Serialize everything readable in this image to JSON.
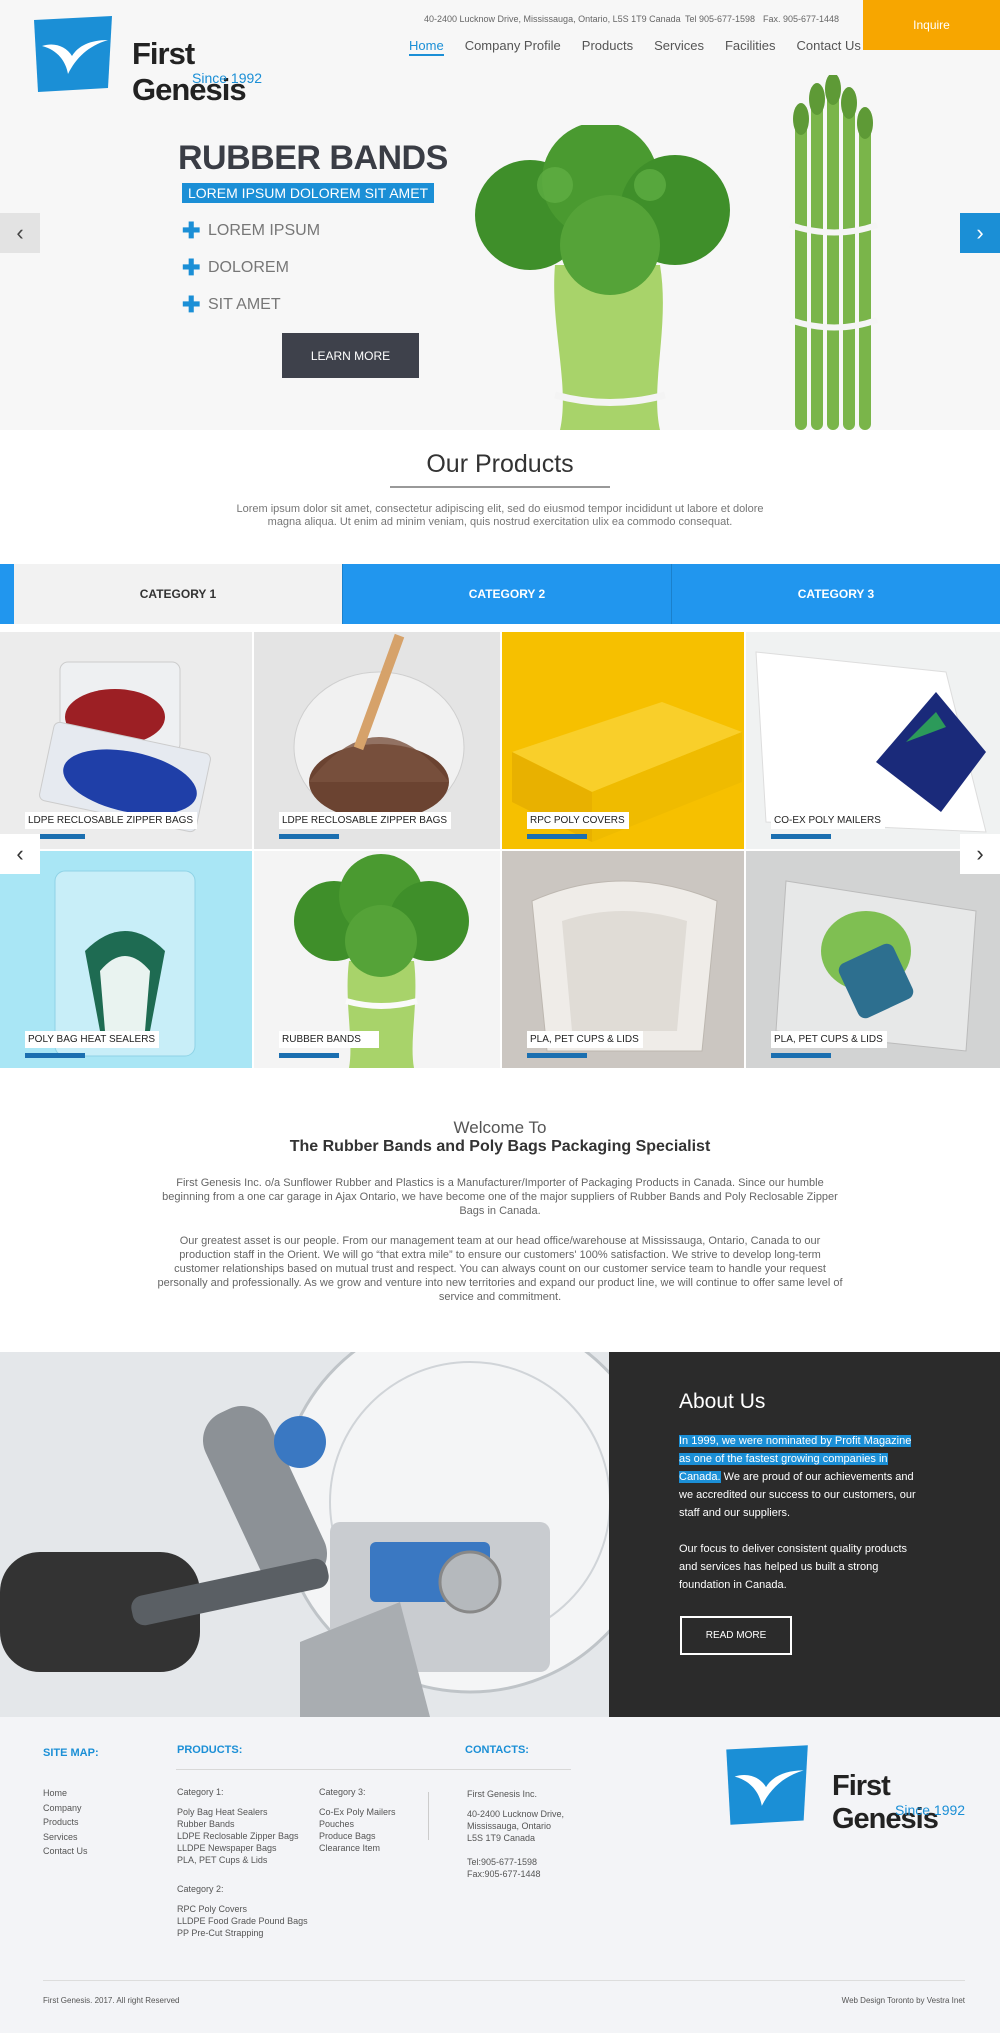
{
  "header": {
    "logo_name": "First Genesis",
    "logo_since": "Since 1992",
    "address": "40-2400 Lucknow Drive, Mississauga, Ontario, L5S 1T9 Canada",
    "tel": "Tel 905-677-1598",
    "fax": "Fax. 905-677-1448",
    "inquire": "Inquire",
    "nav": [
      "Home",
      "Company Profile",
      "Products",
      "Services",
      "Facilities",
      "Contact Us"
    ]
  },
  "hero": {
    "title": "RUBBER BANDS",
    "tagline": "LOREM IPSUM DOLOREM SIT AMET",
    "bullets": [
      "LOREM IPSUM",
      "DOLOREM",
      "SIT AMET"
    ],
    "cta": "LEARN MORE"
  },
  "products": {
    "title": "Our Products",
    "description": "Lorem ipsum dolor sit amet, consectetur adipiscing elit, sed do eiusmod tempor incididunt ut labore et dolore magna aliqua. Ut enim ad minim veniam, quis nostrud exercitation ulix ea commodo consequat.",
    "tabs": [
      "CATEGORY 1",
      "CATEGORY 2",
      "CATEGORY 3"
    ],
    "tiles": [
      "LDPE RECLOSABLE ZIPPER BAGS",
      "LDPE RECLOSABLE ZIPPER BAGS",
      "RPC POLY COVERS",
      "CO-EX POLY MAILERS",
      "POLY BAG HEAT SEALERS",
      "RUBBER BANDS",
      "PLA, PET CUPS & LIDS",
      "PLA, PET CUPS & LIDS"
    ]
  },
  "welcome": {
    "small": "Welcome To",
    "large": "The Rubber Bands and Poly Bags Packaging Specialist",
    "p1": "First Genesis Inc. o/a Sunflower Rubber and Plastics is a Manufacturer/Importer of Packaging Products in Canada. Since our humble beginning from a one car garage in Ajax Ontario, we have become one of the major suppliers of Rubber Bands and Poly Reclosable Zipper Bags in Canada.",
    "p2": "Our greatest asset is our people. From our management team at our head office/warehouse at Mississauga, Ontario, Canada to our production staff in the Orient. We will go “that extra mile” to ensure our customers' 100% satisfaction. We strive to develop long-term customer relationships based on mutual trust and respect. You can always count on our customer service team to handle your request personally and professionally. As we grow and venture into new territories and expand our product line, we will continue to offer same level of service and commitment."
  },
  "about": {
    "title": "About Us",
    "highlight": "In 1999, we were nominated by Profit Magazine as one of the fastest growing companies in Canada.",
    "rest": " We are proud of our achievements and we accredited our success to our customers, our staff and our suppliers.",
    "p2": "Our focus to deliver consistent quality products and services has helped us built a strong foundation in Canada.",
    "cta": "READ MORE"
  },
  "footer": {
    "sitemap_title": "SITE MAP:",
    "sitemap": [
      "Home",
      "Company",
      "Products",
      "Services",
      "Contact Us"
    ],
    "products_title": "PRODUCTS:",
    "cat1_title": "Category 1:",
    "cat1": [
      "Poly Bag Heat Sealers",
      "Rubber Bands",
      "LDPE Reclosable Zipper Bags",
      "LLDPE Newspaper Bags",
      "PLA, PET Cups & Lids"
    ],
    "cat2_title": "Category 2:",
    "cat2": [
      "RPC Poly Covers",
      "LLDPE Food Grade Pound Bags",
      "PP Pre-Cut Strapping"
    ],
    "cat3_title": "Category 3:",
    "cat3": [
      "Co-Ex Poly Mailers",
      "Pouches",
      "Produce Bags",
      "Clearance Item"
    ],
    "contacts_title": "CONTACTS:",
    "company": "First Genesis Inc.",
    "addr": [
      "40-2400 Lucknow Drive,",
      "Mississauga, Ontario",
      "L5S 1T9 Canada"
    ],
    "tel": "Tel:905-677-1598",
    "fax": "Fax:905-677-1448",
    "logo_name": "First Genesis",
    "logo_since": "Since 1992",
    "copyright": "First Genesis.  2017. All right Reserved",
    "credit": "Web Design Toronto by Vestra Inet"
  },
  "colors": {
    "accent": "#1b8fd6",
    "tab_blue": "#2196ee",
    "inquire": "#f7a600",
    "dark": "#2b2b2b"
  }
}
